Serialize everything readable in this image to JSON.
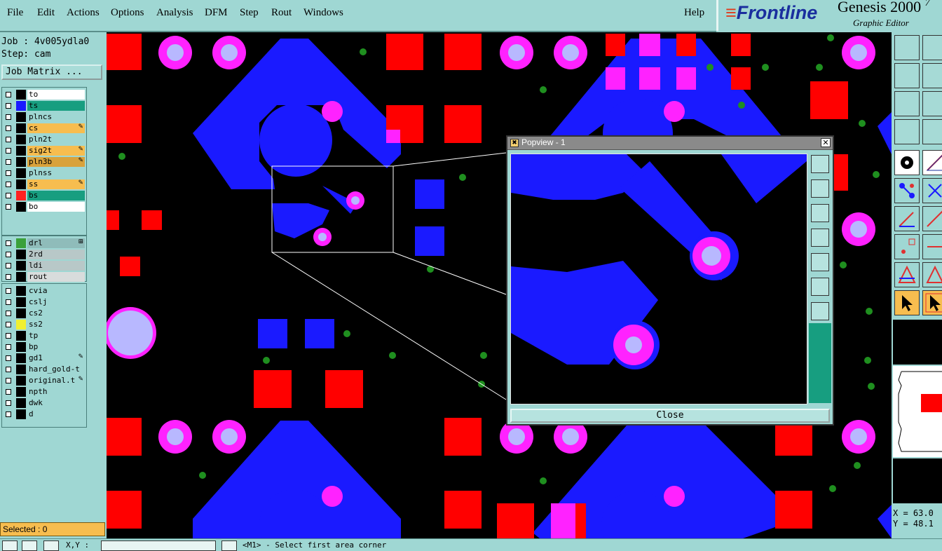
{
  "menu": {
    "file": "File",
    "edit": "Edit",
    "actions": "Actions",
    "options": "Options",
    "analysis": "Analysis",
    "dfm": "DFM",
    "step": "Step",
    "rout": "Rout",
    "windows": "Windows",
    "help": "Help"
  },
  "brand": {
    "logo_mark": "≡",
    "logo_text": "Frontline",
    "title": "Genesis 2000",
    "title_suffix": "7",
    "subtitle": "Graphic Editor"
  },
  "job": {
    "job_line": "Job : 4v005ydla0",
    "step_line": "Step: cam",
    "job_matrix_label": "Job Matrix ..."
  },
  "layers_group1": [
    {
      "name": "to",
      "swatch": "#000000",
      "bg": "#ffffff"
    },
    {
      "name": "ts",
      "swatch": "#1a1aff",
      "bg": "#179e80"
    },
    {
      "name": "plncs",
      "swatch": "#000000",
      "bg": "#9fd7d3"
    },
    {
      "name": "cs",
      "swatch": "#000000",
      "bg": "#f7bd4f",
      "mark": "✎"
    },
    {
      "name": "pln2t",
      "swatch": "#000000",
      "bg": "#9fd7d3"
    },
    {
      "name": "sig2t",
      "swatch": "#000000",
      "bg": "#f7bd4f",
      "mark": "✎"
    },
    {
      "name": "pln3b",
      "swatch": "#000000",
      "bg": "#d9a23b",
      "mark": "✎"
    },
    {
      "name": "plnss",
      "swatch": "#000000",
      "bg": "#9fd7d3"
    },
    {
      "name": "ss",
      "swatch": "#000000",
      "bg": "#f7bd4f",
      "mark": "✎"
    },
    {
      "name": "bs",
      "swatch": "#ff2020",
      "bg": "#179e80"
    },
    {
      "name": "bo",
      "swatch": "#000000",
      "bg": "#ffffff"
    }
  ],
  "layers_group2": [
    {
      "name": "drl",
      "swatch": "#3aa03a",
      "bg": "#8fbcba",
      "mark": "⊞"
    },
    {
      "name": "2rd",
      "swatch": "#000000",
      "bg": "#b8c8c8"
    },
    {
      "name": "ldi",
      "swatch": "#000000",
      "bg": "#b8c8c8"
    },
    {
      "name": "rout",
      "swatch": "#000000",
      "bg": "#d8dcdc"
    }
  ],
  "layers_group3": [
    {
      "name": "cvia",
      "swatch": "#000000",
      "bg": "#9fd7d3"
    },
    {
      "name": "cslj",
      "swatch": "#000000",
      "bg": "#9fd7d3"
    },
    {
      "name": "cs2",
      "swatch": "#000000",
      "bg": "#9fd7d3"
    },
    {
      "name": "ss2",
      "swatch": "#f0f030",
      "bg": "#9fd7d3"
    },
    {
      "name": "tp",
      "swatch": "#000000",
      "bg": "#9fd7d3"
    },
    {
      "name": "bp",
      "swatch": "#000000",
      "bg": "#9fd7d3"
    },
    {
      "name": "gd1",
      "swatch": "#000000",
      "bg": "#9fd7d3",
      "mark": "✎"
    },
    {
      "name": "hard_gold-t",
      "swatch": "#000000",
      "bg": "#9fd7d3"
    },
    {
      "name": "original.t",
      "swatch": "#000000",
      "bg": "#9fd7d3",
      "mark": "✎"
    },
    {
      "name": "npth",
      "swatch": "#000000",
      "bg": "#9fd7d3"
    },
    {
      "name": "dwk",
      "swatch": "#000000",
      "bg": "#9fd7d3"
    },
    {
      "name": "d",
      "swatch": "#000000",
      "bg": "#9fd7d3"
    }
  ],
  "selected_label": "Selected : 0",
  "popview": {
    "title": "Popview - 1",
    "close_label": "Close"
  },
  "coords": {
    "x_label": "X = 63.0",
    "y_label": "Y = 48.1"
  },
  "status": {
    "xy_label": "X,Y :",
    "prompt": "<M1> - Select first area corner"
  },
  "colors": {
    "pad_red": "#ff0000",
    "trace_blue": "#1a1aff",
    "ring_magenta": "#ff22ff",
    "drill_lavender": "#b8b8ff",
    "via_green": "#1f8f1f",
    "panel_teal": "#9fd7d3"
  }
}
